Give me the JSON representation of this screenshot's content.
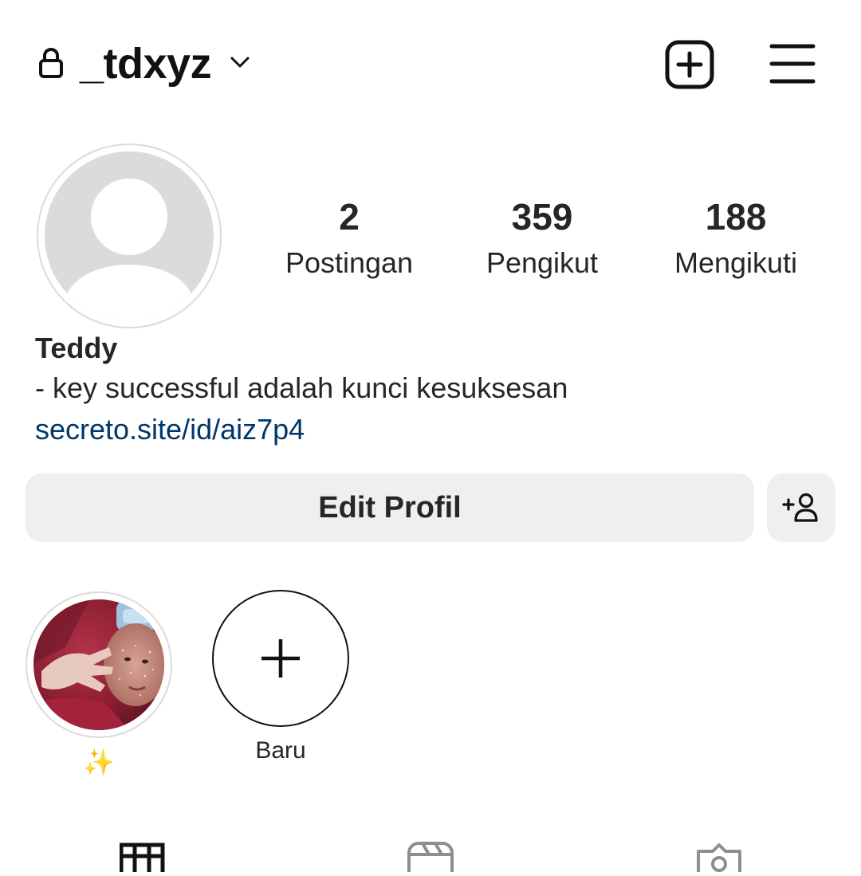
{
  "header": {
    "username": "_tdxyz"
  },
  "profile": {
    "display_name": "Teddy",
    "bio": "- key successful adalah kunci kesuksesan",
    "link": "secreto.site/id/aiz7p4"
  },
  "stats": [
    {
      "value": "2",
      "label": "Postingan"
    },
    {
      "value": "359",
      "label": "Pengikut"
    },
    {
      "value": "188",
      "label": "Mengikuti"
    }
  ],
  "actions": {
    "edit_profile_label": "Edit Profil"
  },
  "highlights": [
    {
      "label": "✨"
    },
    {
      "label": "Baru"
    }
  ],
  "icons": {
    "lock": "lock-icon",
    "dropdown": "chevron-down-icon",
    "create": "add-square-icon",
    "menu": "hamburger-menu-icon",
    "add_person": "add-person-icon",
    "plus": "plus-icon",
    "tabs": [
      "grid-icon",
      "reels-icon",
      "tagged-icon"
    ]
  },
  "colors": {
    "text": "#262626",
    "link": "#00376b",
    "button_bg": "#efefef",
    "avatar_placeholder": "#dbdbdb"
  }
}
